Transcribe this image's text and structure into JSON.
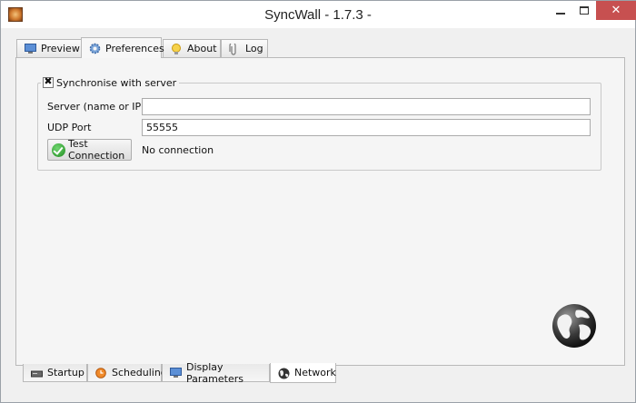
{
  "window": {
    "title": "SyncWall - 1.7.3 -",
    "close_glyph": "✕"
  },
  "top_tabs": [
    {
      "label": "Preview",
      "icon": "monitor-icon"
    },
    {
      "label": "Preferences",
      "icon": "gear-icon",
      "active": true
    },
    {
      "label": "About",
      "icon": "lightbulb-icon"
    },
    {
      "label": "Log",
      "icon": "paperclip-icon"
    }
  ],
  "network": {
    "sync_group_label": "Synchronise with server",
    "sync_checked_glyph": "✖",
    "server_label": "Server (name or IP)",
    "server_value": "",
    "udp_label": "UDP Port",
    "udp_value": "55555",
    "test_button_label": "Test Connection",
    "status_text": "No connection"
  },
  "bottom_tabs": [
    {
      "label": "Startup",
      "icon": "computer-icon"
    },
    {
      "label": "Scheduling",
      "icon": "clock-icon"
    },
    {
      "label": "Display Parameters",
      "icon": "display-icon"
    },
    {
      "label": "Network",
      "icon": "globe-icon",
      "active": true
    }
  ],
  "colors": {
    "close_button": "#c75050",
    "accent_green": "#1f8a1f"
  }
}
